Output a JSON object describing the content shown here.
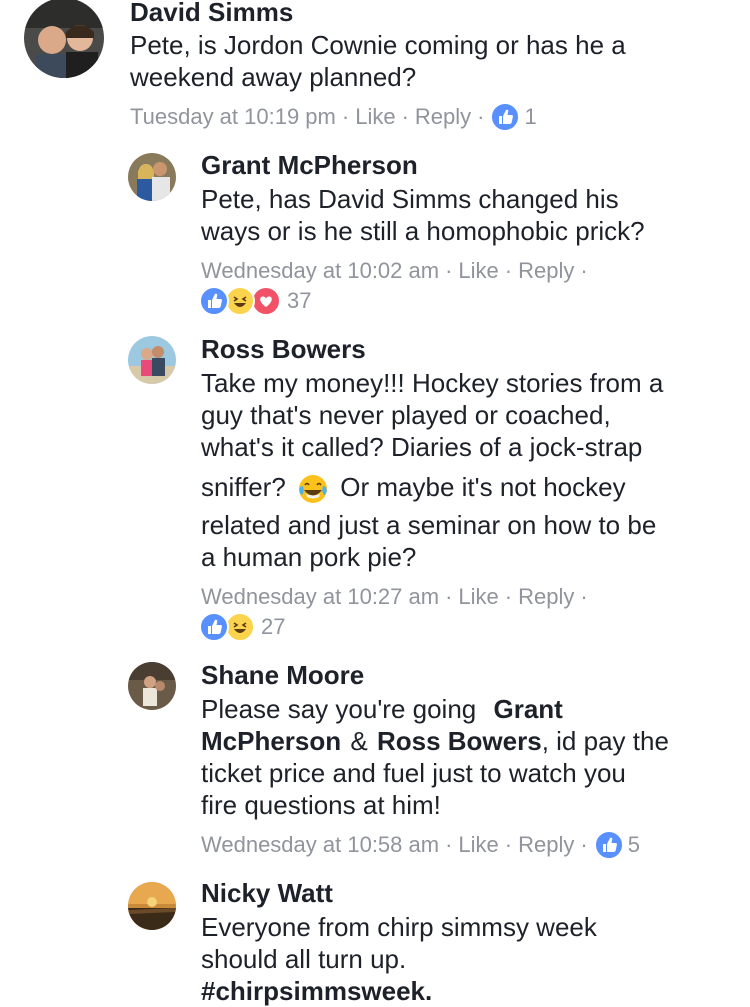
{
  "comments": [
    {
      "author": "David Simms",
      "lines": [
        "Pete, is Jordon Cownie coming or has he a",
        "weekend away planned?"
      ],
      "time": "Tuesday at 10:19 pm",
      "like": "Like",
      "reply": "Reply",
      "reaction_count": "1"
    },
    {
      "author": "Grant McPherson",
      "lines": [
        "Pete, has David Simms changed his",
        "ways or is he still a homophobic prick?"
      ],
      "time": "Wednesday at 10:02 am",
      "like": "Like",
      "reply": "Reply",
      "reaction_count": "37"
    },
    {
      "author": "Ross Bowers",
      "lines": [
        "Take my money!!! Hockey stories from a",
        "guy that's never played or coached,",
        "what's it called? Diaries of a jock-strap",
        "sniffer?",
        "Or maybe it's not hockey",
        "related and just a seminar on how to be",
        "a human pork pie?"
      ],
      "time": "Wednesday at 10:27 am",
      "like": "Like",
      "reply": "Reply",
      "reaction_count": "27"
    },
    {
      "author": "Shane Moore",
      "line1": "Please say you're going",
      "mention1": "Grant",
      "mention1b": "McPherson",
      "amp": "&",
      "mention2": "Ross Bowers",
      "line2_rest": ", id pay the",
      "line3": "ticket price and fuel just to watch you",
      "line4": "fire questions at him!",
      "time": "Wednesday at 10:58 am",
      "like": "Like",
      "reply": "Reply",
      "reaction_count": "5"
    },
    {
      "author": "Nicky Watt",
      "lines": [
        "Everyone from chirp simmsy week",
        "should all turn up.",
        "#chirpsimmsweek."
      ]
    }
  ],
  "colors": {
    "like_blue": "#5890ff",
    "love_red": "#f25268",
    "haha_yellow": "#fcd34d",
    "meta_gray": "#90949c",
    "text": "#1d2129"
  },
  "icons": {
    "like": "thumbs-up-icon",
    "haha": "laughing-face-icon",
    "love": "heart-icon",
    "emoji": "tears-of-joy-emoji"
  }
}
